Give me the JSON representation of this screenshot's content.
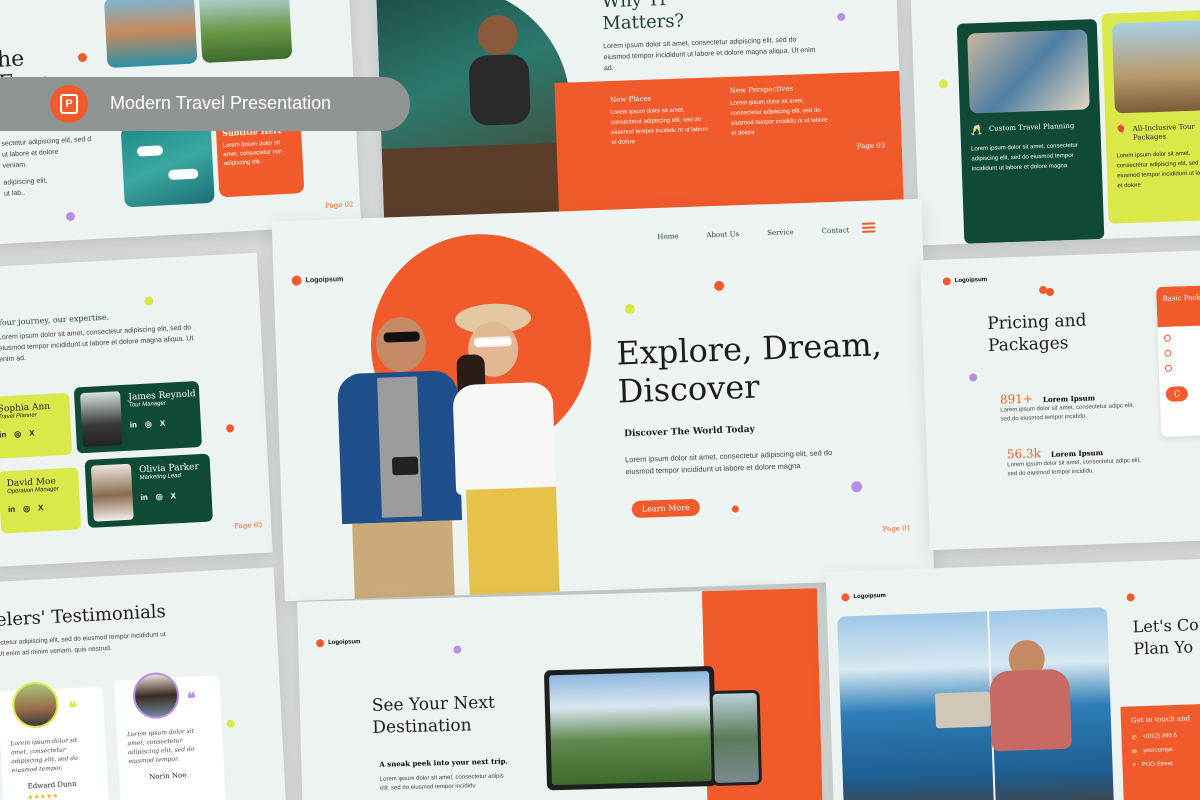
{
  "badge": {
    "text": "Modern Travel Presentation",
    "icon": "powerpoint-icon"
  },
  "colors": {
    "accent": "#f15a2b",
    "green": "#0f4a37",
    "lime": "#dbe84a",
    "bg": "#edf3f0"
  },
  "slide_tl": {
    "title_line1": "he",
    "title_line2": "Ease",
    "body1": "sectetur adipiscing elit, sed d",
    "body2": "ut labore et dolore",
    "body3": "veniam.",
    "body4": "adipiscing elit,",
    "body5": "ut lab..",
    "card_title": "Subtitle Here",
    "card_body": "Lorem ipsum dolor sit amet, consectetur min adipiscing elit.",
    "page": "Page 02"
  },
  "slide_why": {
    "title1": "Why Tr",
    "title2": "Matters?",
    "intro": "Lorem ipsum dolor sit amet, consectetur adipiscing elit, sed do eiusmod tempor incididunt ut labore et dolore magna aliqua. Ut enim ad.",
    "col1_title": "New Places",
    "col1_body": "Lorem ipsum dolor sit amet, consectetur adipiscing elit, sed do eiusmod tempor incididu nt ut labore et dolore",
    "col2_title": "New Perspectives",
    "col2_body": "Lorem ipsum dolor sit amet, consectetur adipiscing elit, sed do eiusmod tempor incididu nt ut labore et dolore",
    "page": "Page 03"
  },
  "slide_tr": {
    "card1_title": "Custom Travel Planning",
    "card1_body": "Lorem ipsum dolor sit amet, consectetur adipiscing elit, sed do eiusmod tempor incididunt ut labore et dolore magna",
    "card2_title": "All-Inclusive Tour Packages",
    "card2_body": "Lorem ipsum dolor sit amet, consectetur adipiscing elit, sed do eiusmod tempor incididunt ut labore et dolore"
  },
  "slide_team": {
    "tagline": "Your journey, our expertise.",
    "body": "Lorem ipsum dolor sit amet, consectetur adipiscing elit, sed do eiusmod tempor incididunt ut labore et dolore magna aliqua. Ut enim ad.",
    "members": [
      {
        "name": "Sophia Ann",
        "role": "Travel Planner"
      },
      {
        "name": "James Reynold",
        "role": "Tour Manager"
      },
      {
        "name": "David Moe",
        "role": "Operation Manager"
      },
      {
        "name": "Olivia Parker",
        "role": "Marketing Lead"
      }
    ],
    "social": {
      "in": "in",
      "ig": "◎",
      "x": "X"
    },
    "page": "Page 05"
  },
  "slide_main": {
    "logo": "Logoipsum",
    "nav": [
      "Home",
      "About Us",
      "Service",
      "Contact"
    ],
    "title_line1": "Explore, Dream,",
    "title_line2": "Discover",
    "subtitle": "Discover The World Today",
    "body": "Lorem ipsum dolor sit amet, consectetur adipiscing elit, sed do eiusmod tempor incididunt ut labore et dolore magna",
    "button": "Learn More",
    "page": "Page 01"
  },
  "slide_pricing": {
    "logo": "Logoipsum",
    "title_line1": "Pricing and",
    "title_line2": "Packages",
    "stat1_value": "891+",
    "stat1_label": "Lorem Ipsum",
    "stat1_body": "Lorem ipsum dolor sit amet, consectetur adipc elit, sed do eiusmod tempor incididu.",
    "stat2_value": "56.3k",
    "stat2_label": "Lorem Ipsum",
    "stat2_body": "Lorem ipsum dolor sit amet, consectetur adipc elit, sed do eiusmod tempor incididu.",
    "pkg_title": "Basic Packag",
    "pkg_button": "C"
  },
  "slide_testimonials": {
    "title": "elers' Testimonials",
    "body": "ectetur adipiscing elit, sed do eiusmod tempor incididunt ut Ut enim ad minim veniam, quis nostrud.",
    "t1_quote": "Lorem ipsum dolor sit amet, consectetur adipiscing elit, sed do eiusmod tempor.",
    "t1_name": "Edward Dunn",
    "t2_quote": "Lorem ipsum dolor sit amet, consectetur adipiscing elit, sed do eiusmod tempor.",
    "t2_name": "Norin Noe",
    "stars": "★★★★★"
  },
  "slide_dest": {
    "logo": "Logoipsum",
    "title_line1": "See Your Next",
    "title_line2": "Destination",
    "subtitle": "A sneak peek into your next trip.",
    "body": "Lorem ipsum dolor sit amet, consectetur adipis elit, sed do eiusmod tempor incididu"
  },
  "slide_contact": {
    "logo": "Logoipsum",
    "title_line1": "Let's Co",
    "title_line2": "Plan Yo",
    "card_title": "Get in touch and",
    "phone": "+(012) 345 6",
    "email": "yourcompa",
    "address": "PUO Street"
  }
}
